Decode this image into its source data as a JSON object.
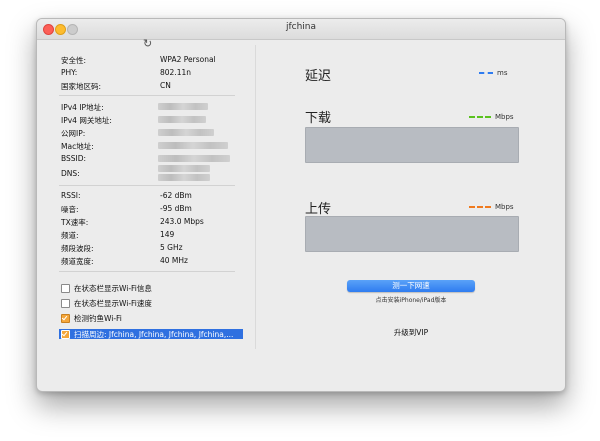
{
  "window": {
    "title": "jfchina"
  },
  "icons": {
    "refresh": "refresh-icon"
  },
  "info": {
    "security": {
      "label": "安全性:",
      "value": "WPA2 Personal"
    },
    "phy": {
      "label": "PHY:",
      "value": "802.11n"
    },
    "country": {
      "label": "国家地区码:",
      "value": "CN"
    },
    "ipv4": {
      "label": "IPv4 IP地址:"
    },
    "gateway": {
      "label": "IPv4 网关地址:"
    },
    "public_ip": {
      "label": "公网IP:"
    },
    "mac": {
      "label": "Mac地址:"
    },
    "bssid": {
      "label": "BSSID:"
    },
    "dns": {
      "label": "DNS:"
    },
    "rssi": {
      "label": "RSSI:",
      "value": "-62 dBm"
    },
    "noise": {
      "label": "噪音:",
      "value": "-95 dBm"
    },
    "tx_rate": {
      "label": "TX速率:",
      "value": "243.0 Mbps"
    },
    "channel": {
      "label": "频道:",
      "value": "149"
    },
    "band": {
      "label": "频段波段:",
      "value": "5 GHz"
    },
    "width": {
      "label": "频道宽度:",
      "value": "40 MHz"
    }
  },
  "options": {
    "show_wifi_info": {
      "label": "在状态栏显示Wi-Fi信息",
      "checked": false
    },
    "show_wifi_speed": {
      "label": "在状态栏显示Wi-Fi速度",
      "checked": false
    },
    "detect_phishing": {
      "label": "检测钓鱼Wi-Fi",
      "checked": true
    },
    "scan_nearby": {
      "label": "扫描周边: Jfchina, Jfchina, Jfchina, Jfchina,...",
      "checked": true
    }
  },
  "speed": {
    "latency": {
      "label": "延迟",
      "unit": "ms",
      "color": "#2f7cf0"
    },
    "download": {
      "label": "下载",
      "unit": "Mbps",
      "color": "#5ac21e"
    },
    "upload": {
      "label": "上传",
      "unit": "Mbps",
      "color": "#f07a1e"
    }
  },
  "actions": {
    "test_button": "测一下网速",
    "ios_link": "点击安装iPhone/iPad版本",
    "vip": "升级到VIP"
  }
}
